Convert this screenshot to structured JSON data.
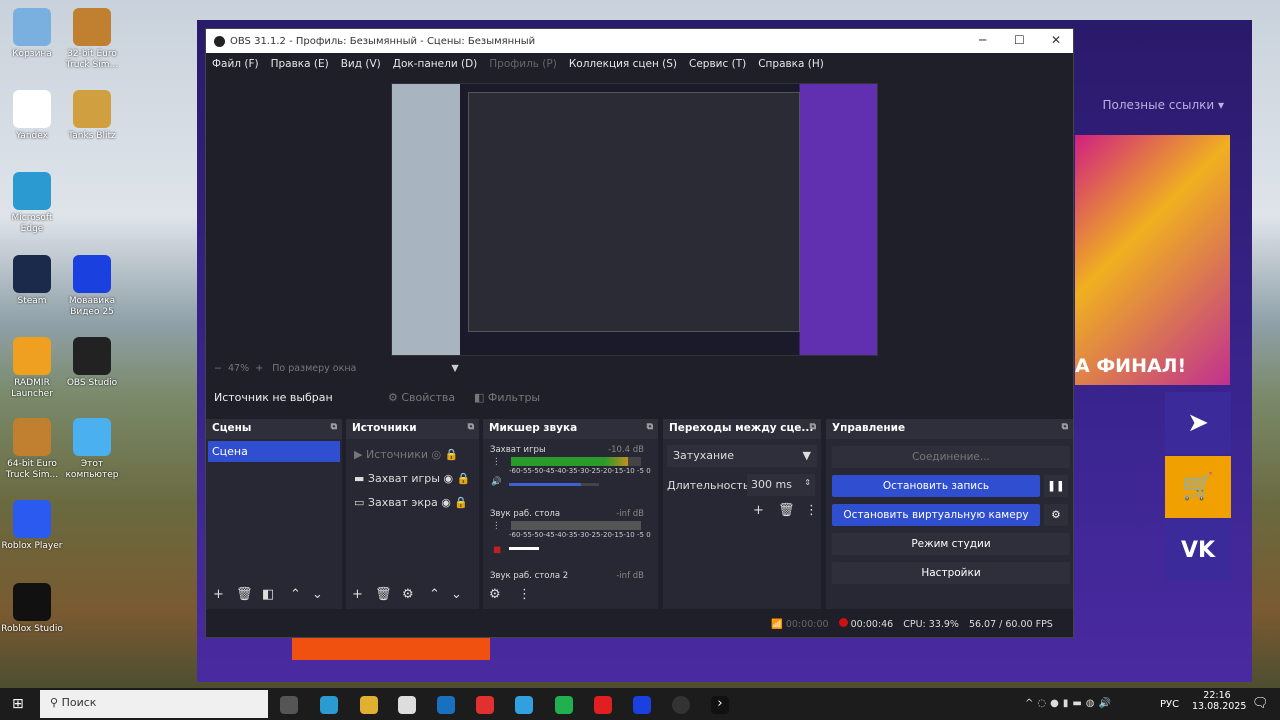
{
  "desktop": {
    "icons": [
      {
        "label": "Корзина",
        "color": "#7ab0e0"
      },
      {
        "label": "32-bit Euro Truck Sim...",
        "color": "#c08030"
      },
      {
        "label": "Yandex",
        "color": "#fff"
      },
      {
        "label": "Tanks Blitz",
        "color": "#d0a040"
      },
      {
        "label": "Microsoft Edge",
        "color": "#2a9ad0"
      },
      {
        "label": "Steam",
        "color": "#1b2a4a"
      },
      {
        "label": "Мовавика Видео 25",
        "color": "#1a40e0"
      },
      {
        "label": "RADMIR Launcher",
        "color": "#f0a020"
      },
      {
        "label": "OBS Studio",
        "color": "#222"
      },
      {
        "label": "64-bit Euro Truck Sim...",
        "color": "#c08030"
      },
      {
        "label": "Этот компьютер",
        "color": "#4ab0f0"
      },
      {
        "label": "Roblox Player",
        "color": "#2a5af0"
      },
      {
        "label": "Roblox Studio",
        "color": "#111"
      }
    ]
  },
  "bg_app": {
    "links_label": "Полезные ссылки ▾",
    "banner": "А ФИНАЛ!"
  },
  "obs": {
    "title": "OBS 31.1.2 - Профиль: Безымянный - Сцены: Безымянный",
    "menu": [
      "Файл (F)",
      "Правка (E)",
      "Вид (V)",
      "Док-панели (D)",
      "Профиль (P)",
      "Коллекция сцен (S)",
      "Сервис (T)",
      "Справка (H)"
    ],
    "zoom_bar": {
      "zoom": "47%",
      "fit": "По размеру окна"
    },
    "source_bar": {
      "no_source": "Источник не выбран",
      "properties": "Свойства",
      "filters": "Фильтры"
    },
    "scenes": {
      "title": "Сцены",
      "items": [
        "Сцена"
      ]
    },
    "sources": {
      "title": "Источники",
      "items": [
        "Источники",
        "Захват игры",
        "Захват экра"
      ]
    },
    "mixer": {
      "title": "Микшер звука",
      "ticks": "-60-55-50-45-40-35-30-25-20-15-10 -5 0",
      "channels": [
        {
          "name": "Захват игры",
          "db": "-10.4 dB",
          "volume": 0.8,
          "level": 0.9
        },
        {
          "name": "Звук раб. стола",
          "db": "-inf dB",
          "volume": 0.25,
          "level": 0
        },
        {
          "name": "Звук раб. стола 2",
          "db": "-inf dB"
        }
      ]
    },
    "transitions": {
      "title": "Переходы между сце...",
      "type": "Затухание",
      "duration_label": "Длительность",
      "duration": "300 ms"
    },
    "controls": {
      "title": "Управление",
      "connecting": "Соединение...",
      "stop_record": "Остановить запись",
      "stop_vcam": "Остановить виртуальную камеру",
      "studio_mode": "Режим студии",
      "settings": "Настройки"
    },
    "status": {
      "stream_time": "00:00:00",
      "rec_time": "00:00:46",
      "cpu": "CPU: 33.9%",
      "fps": "56.07 / 60.00 FPS"
    }
  },
  "taskbar": {
    "search": "Поиск",
    "lang": "РУС",
    "time": "22:16",
    "date": "13.08.2025"
  }
}
